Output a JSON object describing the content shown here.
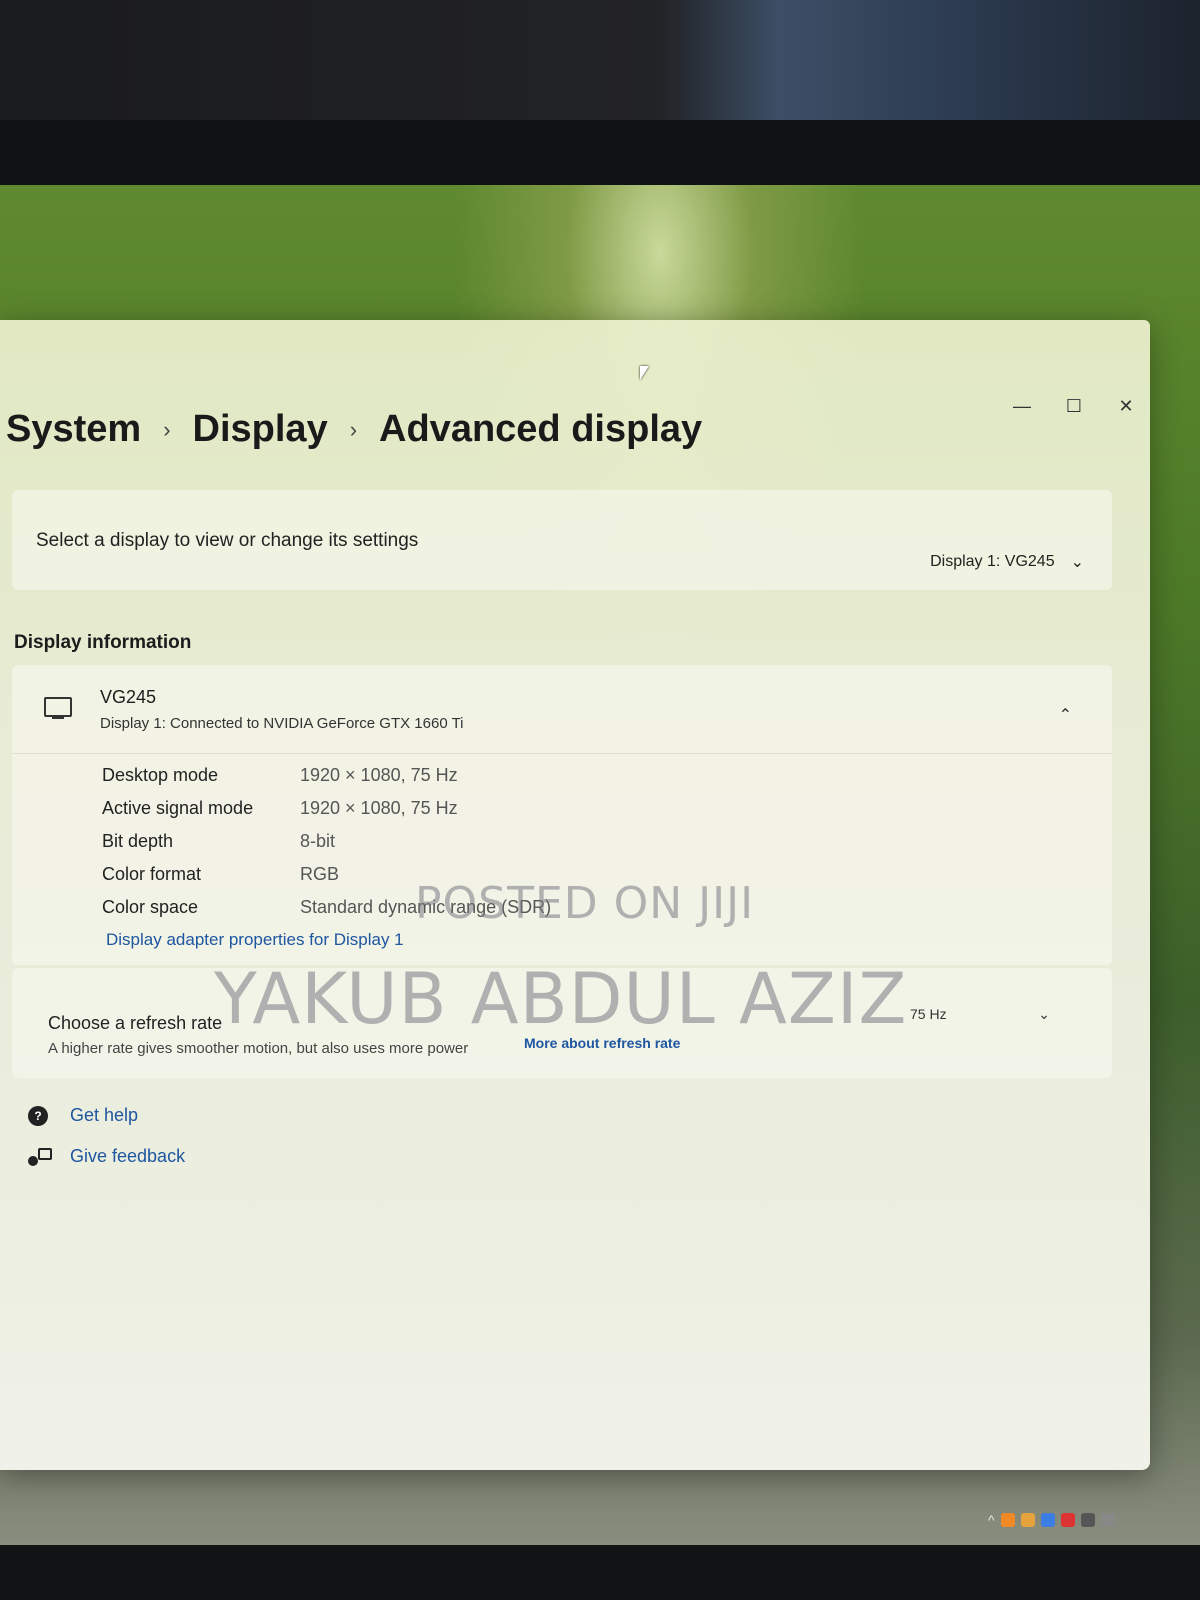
{
  "window": {
    "controls": {
      "minimize": "—",
      "maximize": "☐",
      "close": "✕"
    }
  },
  "breadcrumb": {
    "items": [
      "System",
      "Display",
      "Advanced display"
    ],
    "separator": "›"
  },
  "display_select": {
    "label": "Select a display to view or change its settings",
    "selected": "Display 1: VG245",
    "chevron": "⌄"
  },
  "display_info": {
    "section_title": "Display information",
    "name": "VG245",
    "subtitle": "Display 1: Connected to NVIDIA GeForce GTX 1660 Ti",
    "collapse_chevron": "⌃",
    "specs": [
      {
        "label": "Desktop mode",
        "value": "1920 × 1080, 75 Hz"
      },
      {
        "label": "Active signal mode",
        "value": "1920 × 1080, 75 Hz"
      },
      {
        "label": "Bit depth",
        "value": "8-bit"
      },
      {
        "label": "Color format",
        "value": "RGB"
      },
      {
        "label": "Color space",
        "value": "Standard dynamic range (SDR)"
      }
    ],
    "adapter_link": "Display adapter properties for Display 1"
  },
  "refresh_rate": {
    "title": "Choose a refresh rate",
    "subtitle": "A higher rate gives smoother motion, but also uses more power",
    "link": "More about refresh rate",
    "value": "75 Hz",
    "chevron": "⌄"
  },
  "help": {
    "get_help": "Get help",
    "give_feedback": "Give feedback"
  },
  "watermarks": {
    "line1": "POSTED ON JIJI",
    "line2": "YAKUB ABDUL AZIZ"
  },
  "taskbar": {
    "chevron": "^",
    "icon_colors": [
      "#f08a24",
      "#e6a23c",
      "#3b7de0",
      "#d33",
      "#555",
      "#888"
    ]
  },
  "icons": {
    "monitor": "monitor-icon",
    "help": "help-icon",
    "feedback": "feedback-icon"
  }
}
